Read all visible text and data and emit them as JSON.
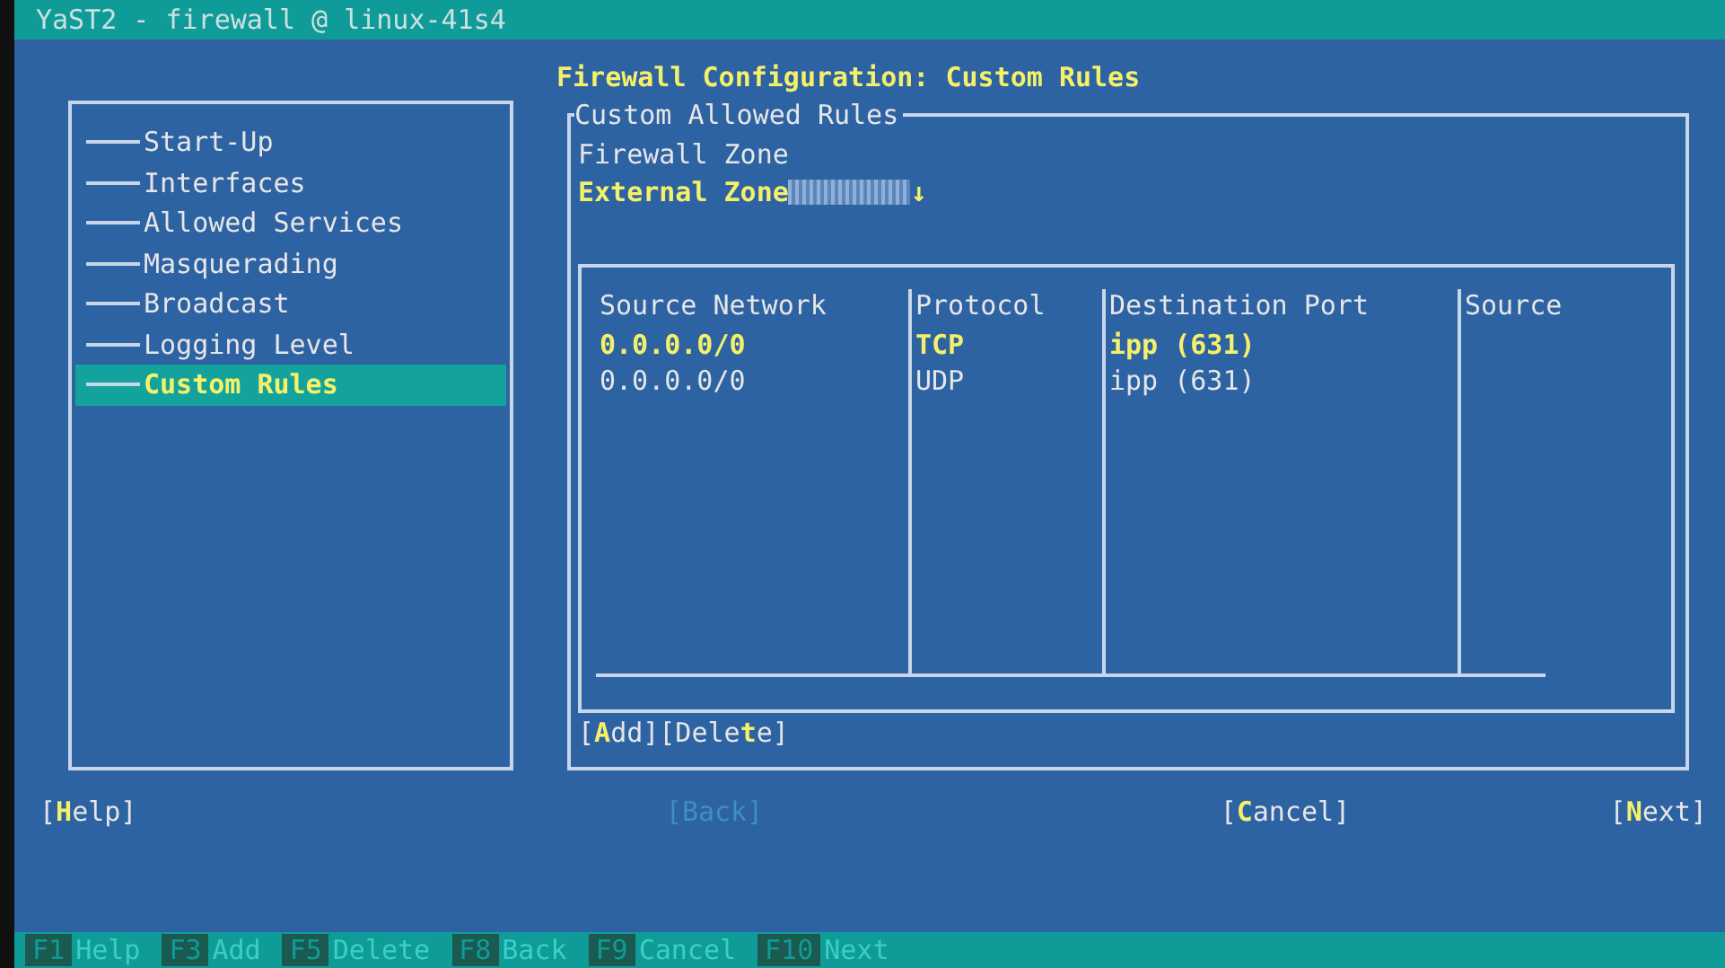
{
  "window": {
    "title": "YaST2 - firewall @ linux-41s4"
  },
  "sidebar": {
    "items": [
      {
        "label": "Start-Up",
        "selected": false
      },
      {
        "label": "Interfaces",
        "selected": false
      },
      {
        "label": "Allowed Services",
        "selected": false
      },
      {
        "label": "Masquerading",
        "selected": false
      },
      {
        "label": "Broadcast",
        "selected": false
      },
      {
        "label": "Logging Level",
        "selected": false
      },
      {
        "label": "Custom Rules",
        "selected": true
      }
    ]
  },
  "heading": "Firewall Configuration: Custom Rules",
  "frame": {
    "title": "Custom Allowed Rules",
    "zone": {
      "label": "Firewall Zone",
      "value": "External Zone",
      "arrow": "↓"
    },
    "table": {
      "columns": [
        "Source Network",
        "Protocol",
        "Destination Port",
        "Source"
      ],
      "rows": [
        {
          "cells": [
            "0.0.0.0/0",
            "TCP",
            "ipp (631)",
            ""
          ],
          "selected": true
        },
        {
          "cells": [
            "0.0.0.0/0",
            "UDP",
            "ipp (631)",
            ""
          ],
          "selected": false
        }
      ]
    },
    "buttons": [
      {
        "before": "[",
        "key": "A",
        "after": "dd]",
        "disabled": false
      },
      {
        "before": "[Dele",
        "key": "t",
        "after": "e]",
        "disabled": false
      }
    ]
  },
  "buttons": [
    {
      "before": "[",
      "key": "H",
      "after": "elp]",
      "disabled": false
    },
    {
      "before": "[",
      "key": "B",
      "after": "ack]",
      "disabled": true
    },
    {
      "before": "[",
      "key": "C",
      "after": "ancel]",
      "disabled": false
    },
    {
      "before": "[",
      "key": "N",
      "after": "ext]",
      "disabled": false
    }
  ],
  "function_keys": [
    {
      "key": "F1",
      "label": "Help"
    },
    {
      "key": "F3",
      "label": "Add"
    },
    {
      "key": "F5",
      "label": "Delete"
    },
    {
      "key": "F8",
      "label": "Back"
    },
    {
      "key": "F9",
      "label": "Cancel"
    },
    {
      "key": "F10",
      "label": "Next"
    }
  ]
}
